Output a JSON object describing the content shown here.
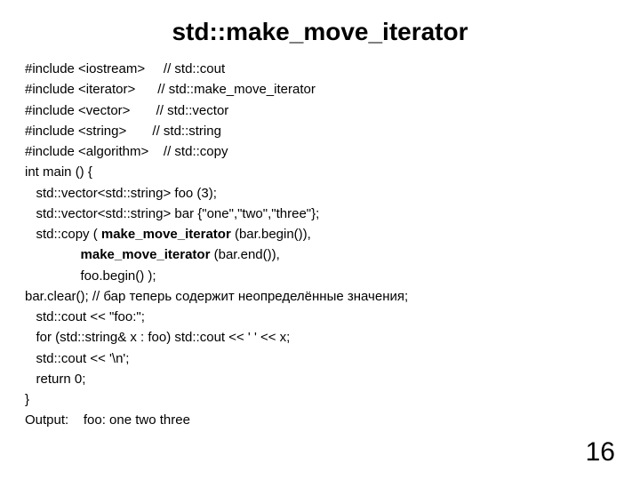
{
  "title": "std::make_move_iterator",
  "lines": {
    "l1_a": "#include <iostream>     // std::",
    "l1_b": "cout",
    "l2": "#include <iterator>      // std::make_move_iterator",
    "l3": "#include <vector>       // std::vector",
    "l4": "#include <string>       // std::string",
    "l5_a": "#include <algorithm>    // std::",
    "l5_b": "copy",
    "l6": "int main () {",
    "l7": "   std::vector<std::string> foo (3);",
    "l8": "   std::vector<std::string> bar {\"one\",\"two\",\"three\"};",
    "l9_a": "   std::",
    "l9_b": "copy ( ",
    "l9_c": "make_move_iterator",
    "l9_d": " (bar.",
    "l9_e": "begin()),",
    "l10_a": "               ",
    "l10_b": "make_move_iterator",
    "l10_c": " (bar.end()),",
    "l11_a": "               foo.",
    "l11_b": "begin() );",
    "l12_a": "bar.",
    "l12_b": "clear(); // бар теперь содержит неопределённые значения;",
    "l13": "   std::cout << \"foo:\";",
    "l14": "   for (std::string& x : foo) std::cout << ' ' << x;",
    "l15": "   std::cout << '\\n';",
    "l16": "   return 0;",
    "l17": "}",
    "l18": "Output:    foo: one two three"
  },
  "page_number": "16"
}
